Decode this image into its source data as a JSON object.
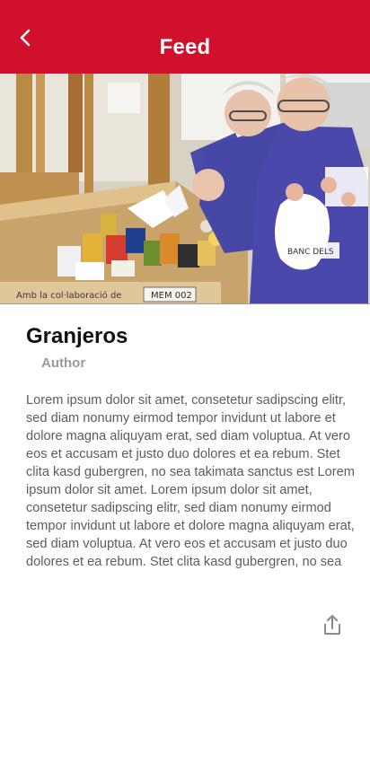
{
  "header": {
    "title": "Feed",
    "back_icon": "chevron-left-icon",
    "background": "#d0102c"
  },
  "hero": {
    "alt": "Food bank volunteers sorting donations",
    "box_text": "Amb la col·laboració de",
    "box_tag": "MEM 002",
    "vest_text": "BANC DELS"
  },
  "post": {
    "title": "Granjeros",
    "author": "Author",
    "body": "Lorem ipsum dolor sit amet, consetetur sadipscing elitr, sed diam nonumy eirmod tempor invidunt ut labore et dolore magna aliquyam erat, sed diam voluptua. At vero eos et accusam et justo duo dolores et ea rebum. Stet clita kasd gubergren, no sea takimata sanctus est Lorem ipsum dolor sit amet. Lorem ipsum dolor sit amet, consetetur sadipscing elitr, sed diam nonumy eirmod tempor invidunt ut labore et dolore magna aliquyam erat, sed diam voluptua. At vero eos et accusam et justo duo dolores et ea rebum. Stet clita kasd gubergren, no sea"
  },
  "actions": {
    "share_icon": "share-icon"
  }
}
